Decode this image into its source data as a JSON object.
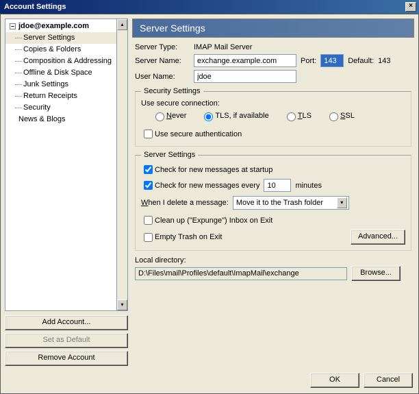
{
  "window": {
    "title": "Account Settings",
    "close_glyph": "×"
  },
  "tree": {
    "root_expand_glyph": "–",
    "root": "jdoe@example.com",
    "items": [
      "Server Settings",
      "Copies & Folders",
      "Composition & Addressing",
      "Offline & Disk Space",
      "Junk Settings",
      "Return Receipts",
      "Security"
    ],
    "root2": "News & Blogs",
    "scroll_up": "▴",
    "scroll_down": "▾",
    "selected_index": 0
  },
  "left_buttons": {
    "add": "Add Account...",
    "default": "Set as Default",
    "remove": "Remove Account"
  },
  "panel": {
    "title": "Server Settings"
  },
  "server": {
    "type_label": "Server Type:",
    "type_value": "IMAP Mail Server",
    "name_label": "Server Name:",
    "name_value": "exchange.example.com",
    "port_label": "Port:",
    "port_value": "143",
    "default_label": "Default:",
    "default_value": "143",
    "user_label": "User Name:",
    "user_value": "jdoe"
  },
  "security": {
    "legend": "Security Settings",
    "use_secure_label": "Use secure connection:",
    "opts": {
      "never_pre": "",
      "never_u": "N",
      "never_post": "ever",
      "tls_if": "TLS, if available",
      "tls_u": "T",
      "tls_post": "LS",
      "ssl_u": "S",
      "ssl_post": "SL"
    },
    "auth_label": "Use secure authentication"
  },
  "server_settings": {
    "legend": "Server Settings",
    "check_startup": "Check for new messages at startup",
    "check_every_pre": "Check for new messages every",
    "check_every_val": "10",
    "check_every_post": "minutes",
    "delete_pre": "",
    "delete_u": "W",
    "delete_post": "hen I delete a message:",
    "delete_select": "Move it to the Trash folder",
    "select_arrow": "▾",
    "cleanup": "Clean up (\"Expunge\") Inbox on Exit",
    "empty": "Empty Trash on Exit",
    "advanced": "Advanced..."
  },
  "local": {
    "label": "Local directory:",
    "value": "D:\\Files\\mail\\Profiles\\default\\ImapMail\\exchange",
    "browse": "Browse..."
  },
  "bottom": {
    "ok": "OK",
    "cancel": "Cancel"
  }
}
